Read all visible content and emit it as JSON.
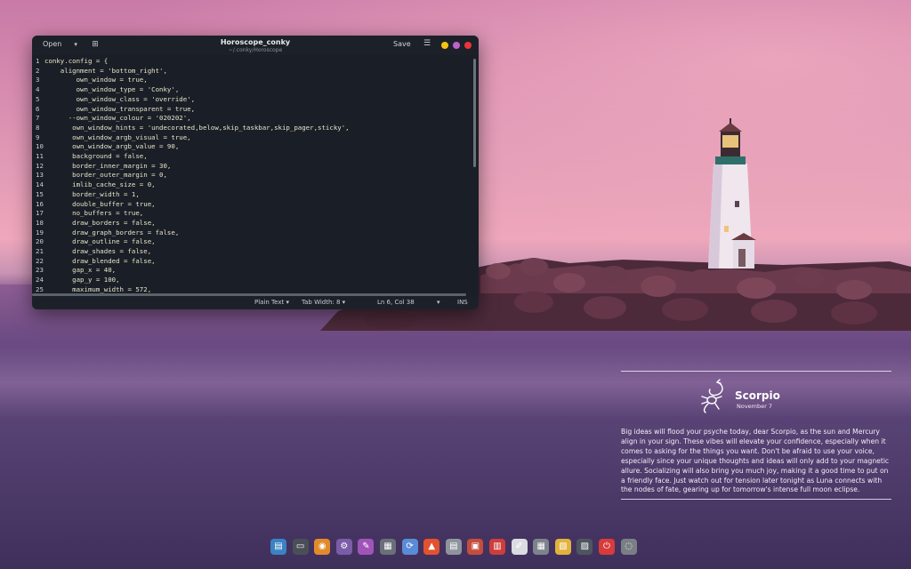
{
  "editor": {
    "open_label": "Open",
    "title": "Horoscope_conky",
    "path": "~/.conky/Horoscope",
    "save_label": "Save",
    "menu_icon": "hamburger-menu-icon",
    "window_controls": [
      {
        "name": "minimize",
        "color": "#f5c211"
      },
      {
        "name": "maximize",
        "color": "#c061cb"
      },
      {
        "name": "close",
        "color": "#ed333b"
      }
    ],
    "lines": [
      {
        "n": "1",
        "text": "conky.config = {"
      },
      {
        "n": "2",
        "text": "    alignment = 'bottom_right',"
      },
      {
        "n": "3",
        "text": "        own_window = true,"
      },
      {
        "n": "4",
        "text": "        own_window_type = 'Conky',"
      },
      {
        "n": "5",
        "text": "        own_window_class = 'override',"
      },
      {
        "n": "6",
        "text": "        own_window_transparent = true,"
      },
      {
        "n": "7",
        "text": "      --own_window_colour = '020202',"
      },
      {
        "n": "8",
        "text": "       own_window_hints = 'undecorated,below,skip_taskbar,skip_pager,sticky',"
      },
      {
        "n": "9",
        "text": "       own_window_argb_visual = true,"
      },
      {
        "n": "10",
        "text": "       own_window_argb_value = 90,"
      },
      {
        "n": "11",
        "text": "       background = false,"
      },
      {
        "n": "12",
        "text": "       border_inner_margin = 30,"
      },
      {
        "n": "13",
        "text": "       border_outer_margin = 0,"
      },
      {
        "n": "14",
        "text": "       imlib_cache_size = 0,"
      },
      {
        "n": "15",
        "text": "       border_width = 1,"
      },
      {
        "n": "16",
        "text": "       double_buffer = true,"
      },
      {
        "n": "17",
        "text": "       no_buffers = true,"
      },
      {
        "n": "18",
        "text": "       draw_borders = false,"
      },
      {
        "n": "19",
        "text": "       draw_graph_borders = false,"
      },
      {
        "n": "20",
        "text": "       draw_outline = false,"
      },
      {
        "n": "21",
        "text": "       draw_shades = false,"
      },
      {
        "n": "22",
        "text": "       draw_blended = false,"
      },
      {
        "n": "23",
        "text": "       gap_x = 40,"
      },
      {
        "n": "24",
        "text": "       gap_y = 100,"
      },
      {
        "n": "25",
        "text": "       maximum_width = 572,"
      }
    ],
    "status": {
      "language": "Plain Text",
      "tab_width": "Tab Width: 8",
      "position": "Ln 6, Col 38",
      "mode": "INS"
    }
  },
  "horoscope": {
    "sign": "Scorpio",
    "date": "November 7",
    "text": "Big ideas will flood your psyche today, dear Scorpio, as the sun and Mercury align in your sign. These vibes will elevate your confidence, especially when it comes to asking for the things you want. Don't be afraid to use your voice, especially since your unique thoughts and ideas will only add to your magnetic allure. Socializing will also bring you much joy, making it a good time to put on a friendly face. Just watch out for tension later tonight as Luna connects with the nodes of fate, gearing up for tomorrow's intense full moon eclipse."
  },
  "dock": {
    "icons": [
      {
        "name": "files-icon",
        "color": "#3b82c4"
      },
      {
        "name": "terminal-icon",
        "color": "#4a4f57"
      },
      {
        "name": "browser-icon",
        "color": "#e08c2b"
      },
      {
        "name": "settings-icon",
        "color": "#7b5ca8"
      },
      {
        "name": "tweaks-icon",
        "color": "#a154b8"
      },
      {
        "name": "gallery-icon",
        "color": "#6a6f78"
      },
      {
        "name": "sync-icon",
        "color": "#5a8bd6"
      },
      {
        "name": "brave-icon",
        "color": "#e2522f"
      },
      {
        "name": "text-editor-icon",
        "color": "#8e949c"
      },
      {
        "name": "image-viewer-icon",
        "color": "#c54d3e"
      },
      {
        "name": "office-icon",
        "color": "#cc3d3d"
      },
      {
        "name": "draw-icon",
        "color": "#d9dce0"
      },
      {
        "name": "calendar-icon",
        "color": "#7d838c"
      },
      {
        "name": "archive-icon",
        "color": "#e2b23c"
      },
      {
        "name": "software-icon",
        "color": "#4f5560"
      },
      {
        "name": "power-icon",
        "color": "#d83b3b"
      },
      {
        "name": "trash-icon",
        "color": "#7a7f86"
      }
    ]
  }
}
